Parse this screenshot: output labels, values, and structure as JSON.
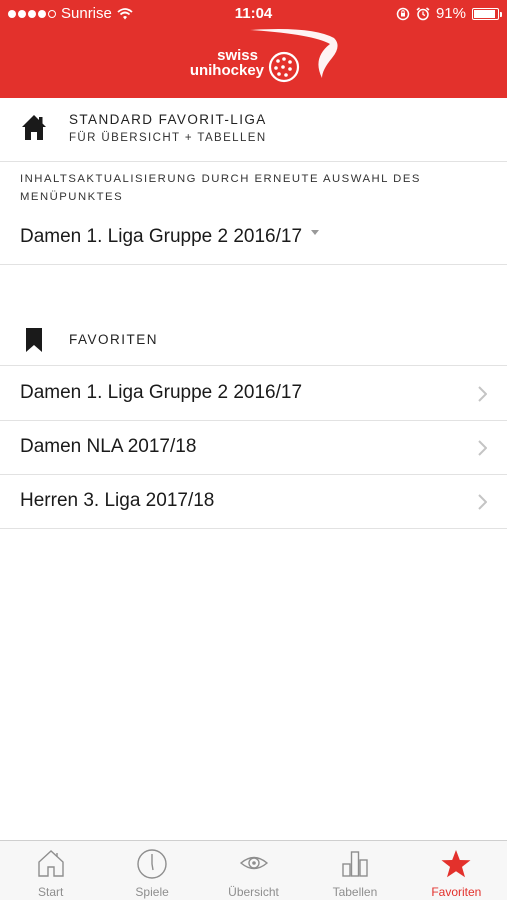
{
  "status_bar": {
    "carrier": "Sunrise",
    "time": "11:04",
    "battery": "91%",
    "battery_level": 0.91,
    "signal_bars_filled": 4
  },
  "header": {
    "logo_line1": "swiss",
    "logo_line2": "unihockey",
    "brand_color": "#e3312c"
  },
  "default_league": {
    "icon": "home-icon",
    "title": "STANDARD FAVORIT-LIGA",
    "subtitle": "FÜR ÜBERSICHT + TABELLEN",
    "info": "INHALTSAKTUALISIERUNG DURCH ERNEUTE AUSWAHL DES MENÜPUNKTES",
    "selected": "Damen 1. Liga Gruppe 2 2016/17"
  },
  "favorites": {
    "icon": "bookmark-icon",
    "label": "FAVORITEN",
    "items": [
      {
        "label": "Damen 1. Liga Gruppe 2 2016/17"
      },
      {
        "label": "Damen NLA 2017/18"
      },
      {
        "label": "Herren 3. Liga 2017/18"
      }
    ]
  },
  "tabbar": {
    "active": "Favoriten",
    "active_color": "#e3312c",
    "tabs": [
      {
        "label": "Start",
        "icon": "home-outline-icon"
      },
      {
        "label": "Spiele",
        "icon": "clock-icon"
      },
      {
        "label": "Übersicht",
        "icon": "eye-icon"
      },
      {
        "label": "Tabellen",
        "icon": "bar-chart-icon"
      },
      {
        "label": "Favoriten",
        "icon": "star-icon"
      }
    ]
  }
}
